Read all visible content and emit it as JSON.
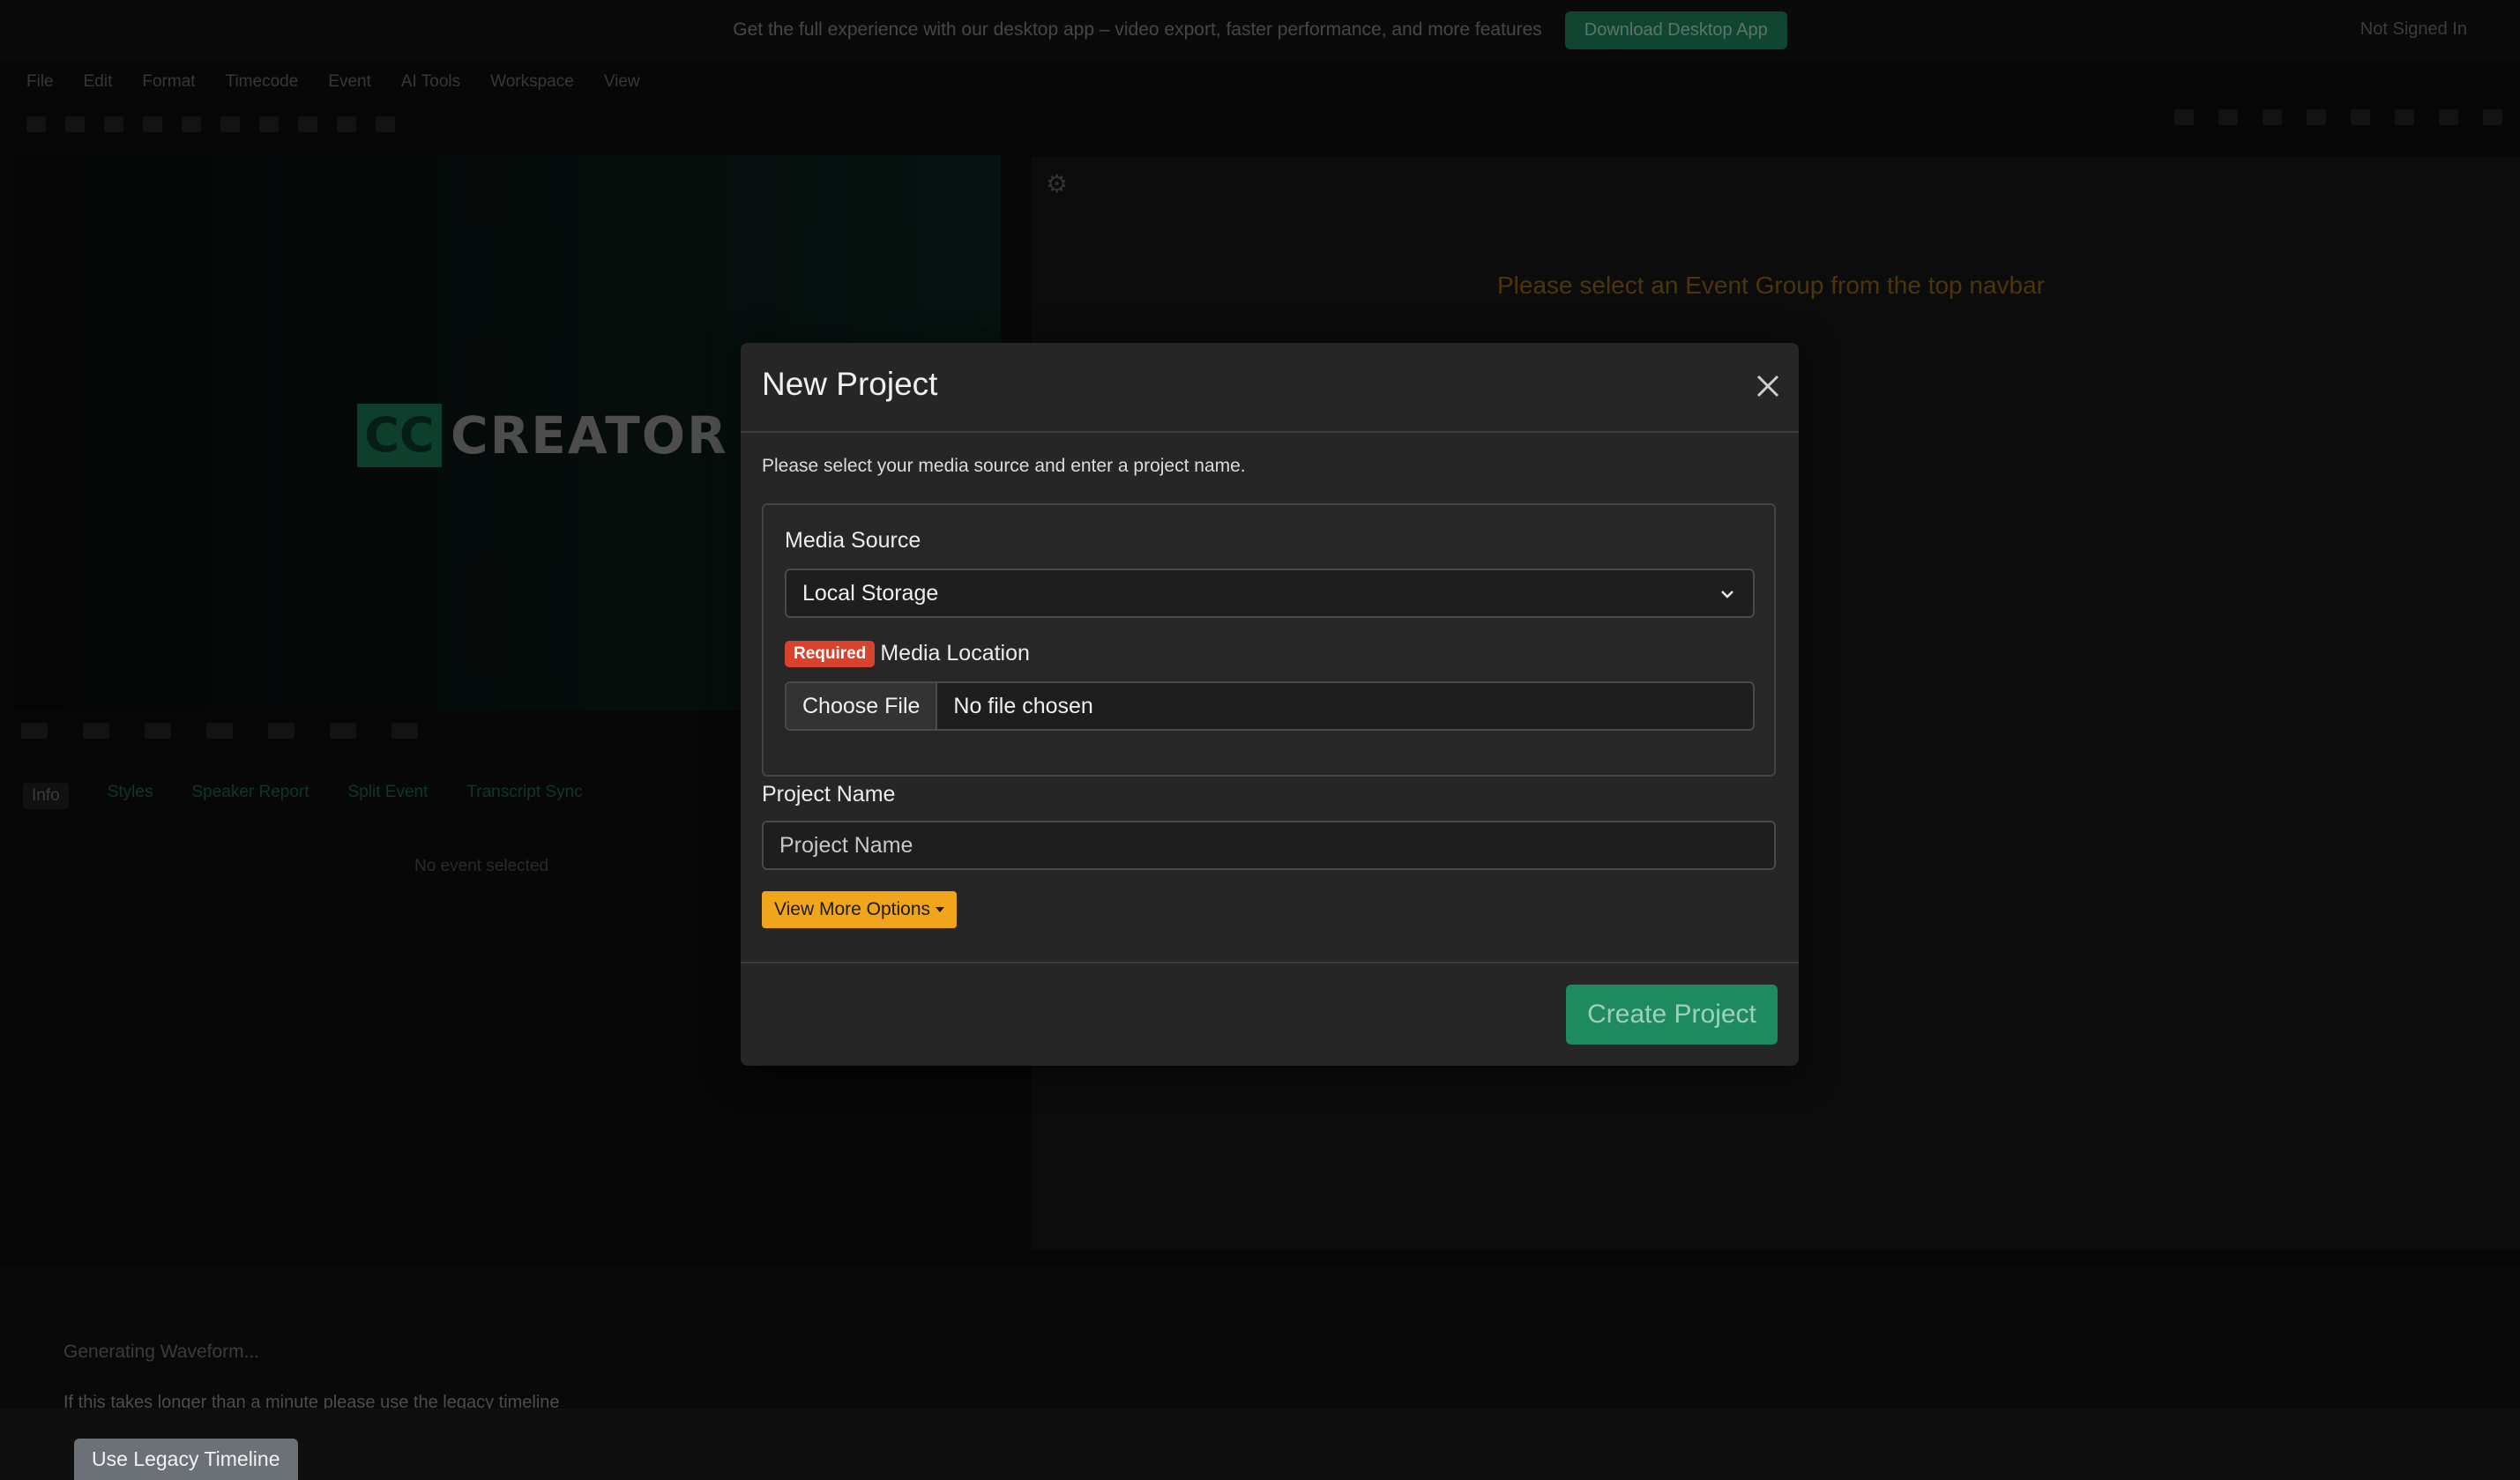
{
  "banner": {
    "message": "Get the full experience with our desktop app – video export, faster performance, and more features",
    "download_label": "Download Desktop App",
    "signin_label": "Not Signed In"
  },
  "menu": [
    "File",
    "Edit",
    "Format",
    "Timecode",
    "Event",
    "AI Tools",
    "Workspace",
    "View"
  ],
  "preview": {
    "logo_mark": "CC",
    "logo_word": "CREATOR"
  },
  "tabs": [
    "Info",
    "Styles",
    "Speaker Report",
    "Split Event",
    "Transcript Sync"
  ],
  "events": {
    "empty_text": "No event selected"
  },
  "right_panel": {
    "warning": "Please select an Event Group from the top navbar"
  },
  "bottom": {
    "generating": "Generating Waveform...",
    "hint": "If this takes longer than a minute please use the legacy timeline",
    "legacy_button": "Use Legacy Timeline"
  },
  "modal": {
    "title": "New Project",
    "intro": "Please select your media source and enter a project name.",
    "media_source_label": "Media Source",
    "media_source_value": "Local Storage",
    "required_badge": "Required",
    "media_location_label": "Media Location",
    "choose_file_label": "Choose File",
    "no_file_label": "No file chosen",
    "project_name_label": "Project Name",
    "project_name_placeholder": "Project Name",
    "more_options_label": "View More Options",
    "create_label": "Create Project"
  },
  "colors": {
    "accent_green": "#1d8a60",
    "warning_orange": "#f0a51a",
    "required_red": "#d9432e"
  }
}
